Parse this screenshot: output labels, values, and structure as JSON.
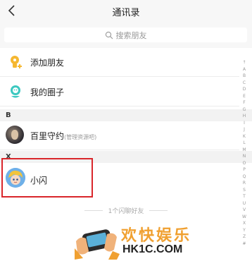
{
  "header": {
    "title": "通讯录"
  },
  "search": {
    "placeholder": "搜索朋友"
  },
  "actions": [
    {
      "label": "添加朋友"
    },
    {
      "label": "我的圈子"
    }
  ],
  "sections": [
    {
      "letter": "B",
      "contacts": [
        {
          "name": "百里守约",
          "note": "(管理资源吧)"
        }
      ]
    },
    {
      "letter": "X",
      "contacts": [
        {
          "name": "小闪"
        }
      ]
    }
  ],
  "alphabet": [
    "↑",
    "A",
    "B",
    "C",
    "D",
    "E",
    "F",
    "G",
    "H",
    "I",
    "J",
    "K",
    "L",
    "M",
    "N",
    "O",
    "P",
    "Q",
    "R",
    "S",
    "T",
    "U",
    "V",
    "W",
    "X",
    "Y",
    "Z",
    "#"
  ],
  "footer": {
    "count_text": "1个闪聊好友"
  },
  "watermark": {
    "title": "欢快娱乐",
    "url": "HK1C.COM"
  },
  "colors": {
    "highlight": "#d9262b",
    "add_friend_icon": "#f5b731",
    "circle_icon": "#3cc8c0"
  }
}
